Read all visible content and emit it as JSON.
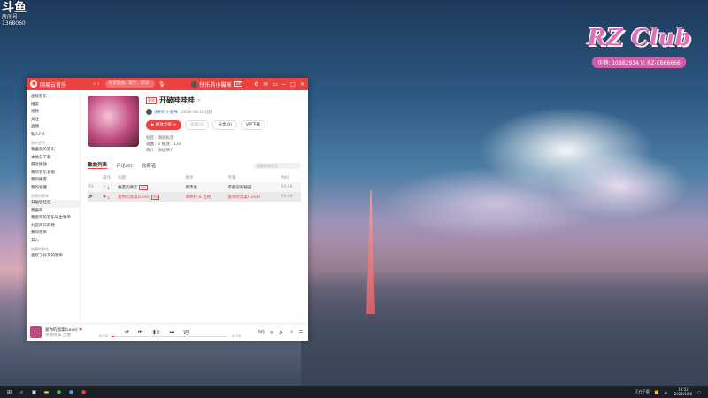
{
  "desktop": {
    "overlay_top_left": {
      "title": "斗鱼",
      "subtitle": "房间号",
      "room_id": "1368060"
    },
    "overlay_top_right": {
      "brand": "RZ Club",
      "contact": "企鹅: 10882934  V: RZ-C666666"
    }
  },
  "app": {
    "name": "网易云音乐",
    "search_placeholder": "搜索歌曲、歌手、歌词",
    "user_label": "快乐的小猫咪",
    "vip_badge": "VIP",
    "accent": "#ec4141"
  },
  "sidebar": {
    "items": [
      {
        "label": "发现音乐"
      },
      {
        "label": "播客"
      },
      {
        "label": "视频"
      },
      {
        "label": "关注"
      },
      {
        "label": "直播"
      },
      {
        "label": "私人FM"
      }
    ],
    "my_music_title": "我的音乐",
    "my_music": [
      {
        "label": "我喜欢的音乐"
      },
      {
        "label": "本地与下载"
      },
      {
        "label": "最近播放"
      },
      {
        "label": "我的音乐云盘"
      },
      {
        "label": "我的播客"
      },
      {
        "label": "我的收藏"
      }
    ],
    "created_title": "创建的歌单",
    "created": [
      {
        "label": "开破哇哇哇"
      },
      {
        "label": "我喜欢"
      },
      {
        "label": "我喜欢的音乐导出歌单"
      },
      {
        "label": "九首周日的歌"
      },
      {
        "label": "我的歌单"
      },
      {
        "label": "开心"
      }
    ],
    "collected_title": "收藏的歌单",
    "collected": [
      {
        "label": "喜欢了好久的歌单"
      }
    ]
  },
  "playlist": {
    "tag": "歌单",
    "title": "开破哇哇哇",
    "creator": "快乐的小猫咪",
    "created_date": "2020-08-10创建",
    "buttons": {
      "play_all": "播放全部",
      "collect": "收藏(0)",
      "share": "分享(0)",
      "download": "VIP下载"
    },
    "meta": {
      "tags": "标签：添加标签",
      "stats": "歌曲：2   播放：124",
      "intro": "简介：添加简介"
    },
    "tabs": {
      "songs": "歌曲列表",
      "comments": "评论(0)",
      "subscribers": "收藏者"
    },
    "search_placeholder": "搜索歌单音乐",
    "columns": [
      "操作",
      "标题",
      "歌手",
      "专辑",
      "时间"
    ],
    "songs": [
      {
        "no": "01",
        "title": "痛苦的真实",
        "badge": "VIP",
        "singer": "周杰伦",
        "album": "不能说的秘密",
        "time": "03:46"
      },
      {
        "no": "02",
        "title": "爱你的温柔(Love)",
        "badge": "SQ",
        "singer": "单依纯 & 吉他",
        "album": "爱你的温柔(Love)",
        "time": "03:48"
      }
    ]
  },
  "player": {
    "title": "爱你的温柔(Love)",
    "artist": "单依纯 & 吉他",
    "elapsed": "00:00",
    "duration": "03:48",
    "progress": 0.02
  },
  "taskbar": {
    "status": "正在下载",
    "time": "19:52",
    "date": "2022/10/8"
  }
}
